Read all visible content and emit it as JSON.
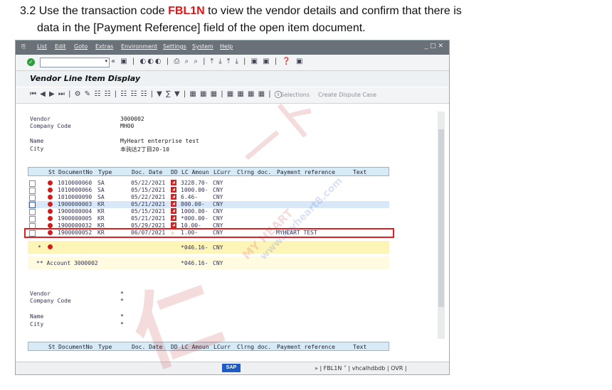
{
  "doc": {
    "line1_prefix": "3.2 Use the transaction code ",
    "line1_code": "FBL1N",
    "line1_suffix": " to view the vendor details and confirm that there is",
    "line2": "data in the [Payment Reference] field of the open item document."
  },
  "menu": [
    "List",
    "Edit",
    "Goto",
    "Extras",
    "Environment",
    "Settings",
    "System",
    "Help"
  ],
  "window_controls": "_ □ ✕",
  "title": "Vendor Line Item Display",
  "toolbar2": {
    "selections": "Selections",
    "create_dispute": "Create Dispute Case"
  },
  "header1": {
    "vendor_label": "Vendor",
    "vendor_value": "3000002",
    "company_label": "Company Code",
    "company_value": "MH00",
    "name_label": "Name",
    "name_value": "MyHeart enterprise test",
    "city_label": "City",
    "city_value": "本驹达2丁目20-10"
  },
  "columns": [
    "St",
    "DocumentNo",
    "Type",
    "Doc. Date",
    "DD",
    "LC Amoun",
    "LCurr",
    "Clrng doc.",
    "Payment reference",
    "Text"
  ],
  "rows": [
    {
      "doc": "1010000060",
      "type": "SA",
      "date": "05/22/2021",
      "amount": "3228.70-",
      "curr": "CNY",
      "payref": ""
    },
    {
      "doc": "1010000066",
      "type": "SA",
      "date": "05/15/2021",
      "amount": "1000.00-",
      "curr": "CNY",
      "payref": ""
    },
    {
      "doc": "1010000090",
      "type": "SA",
      "date": "05/22/2021",
      "amount": "6.46-",
      "curr": "CNY",
      "payref": ""
    },
    {
      "doc": "1900000003",
      "type": "KR",
      "date": "05/21/2021",
      "amount": "800.00-",
      "curr": "CNY",
      "payref": ""
    },
    {
      "doc": "1900000004",
      "type": "KR",
      "date": "05/15/2021",
      "amount": "1000.00-",
      "curr": "CNY",
      "payref": ""
    },
    {
      "doc": "1900000005",
      "type": "KR",
      "date": "05/21/2021",
      "amount": "*000.00-",
      "curr": "CNY",
      "payref": ""
    },
    {
      "doc": "1900000032",
      "type": "KR",
      "date": "05/29/2021",
      "amount": "10.00-",
      "curr": "CNY",
      "payref": ""
    },
    {
      "doc": "1900000052",
      "type": "KR",
      "date": "06/07/2021",
      "amount": "1.00-",
      "curr": "CNY",
      "payref": "MYHEART TEST"
    }
  ],
  "subtotal": {
    "star": "*",
    "amount": "*046.16-",
    "curr": "CNY"
  },
  "account_total": {
    "label": "** Account 3000002",
    "amount": "*046.16-",
    "curr": "CNY"
  },
  "header2": {
    "vendor_label": "Vendor",
    "vendor_value": "*",
    "company_label": "Company Code",
    "company_value": "*",
    "name_label": "Name",
    "name_value": "*",
    "city_label": "City",
    "city_value": "*"
  },
  "status": {
    "sap": "SAP",
    "text": "» | FBL1N ˅ | vhcalhdbdb | OVR |"
  },
  "watermark": {
    "text1": "仁",
    "text2": "一卜",
    "text3": "MY HEART",
    "text4": "www.myheart8.com"
  }
}
